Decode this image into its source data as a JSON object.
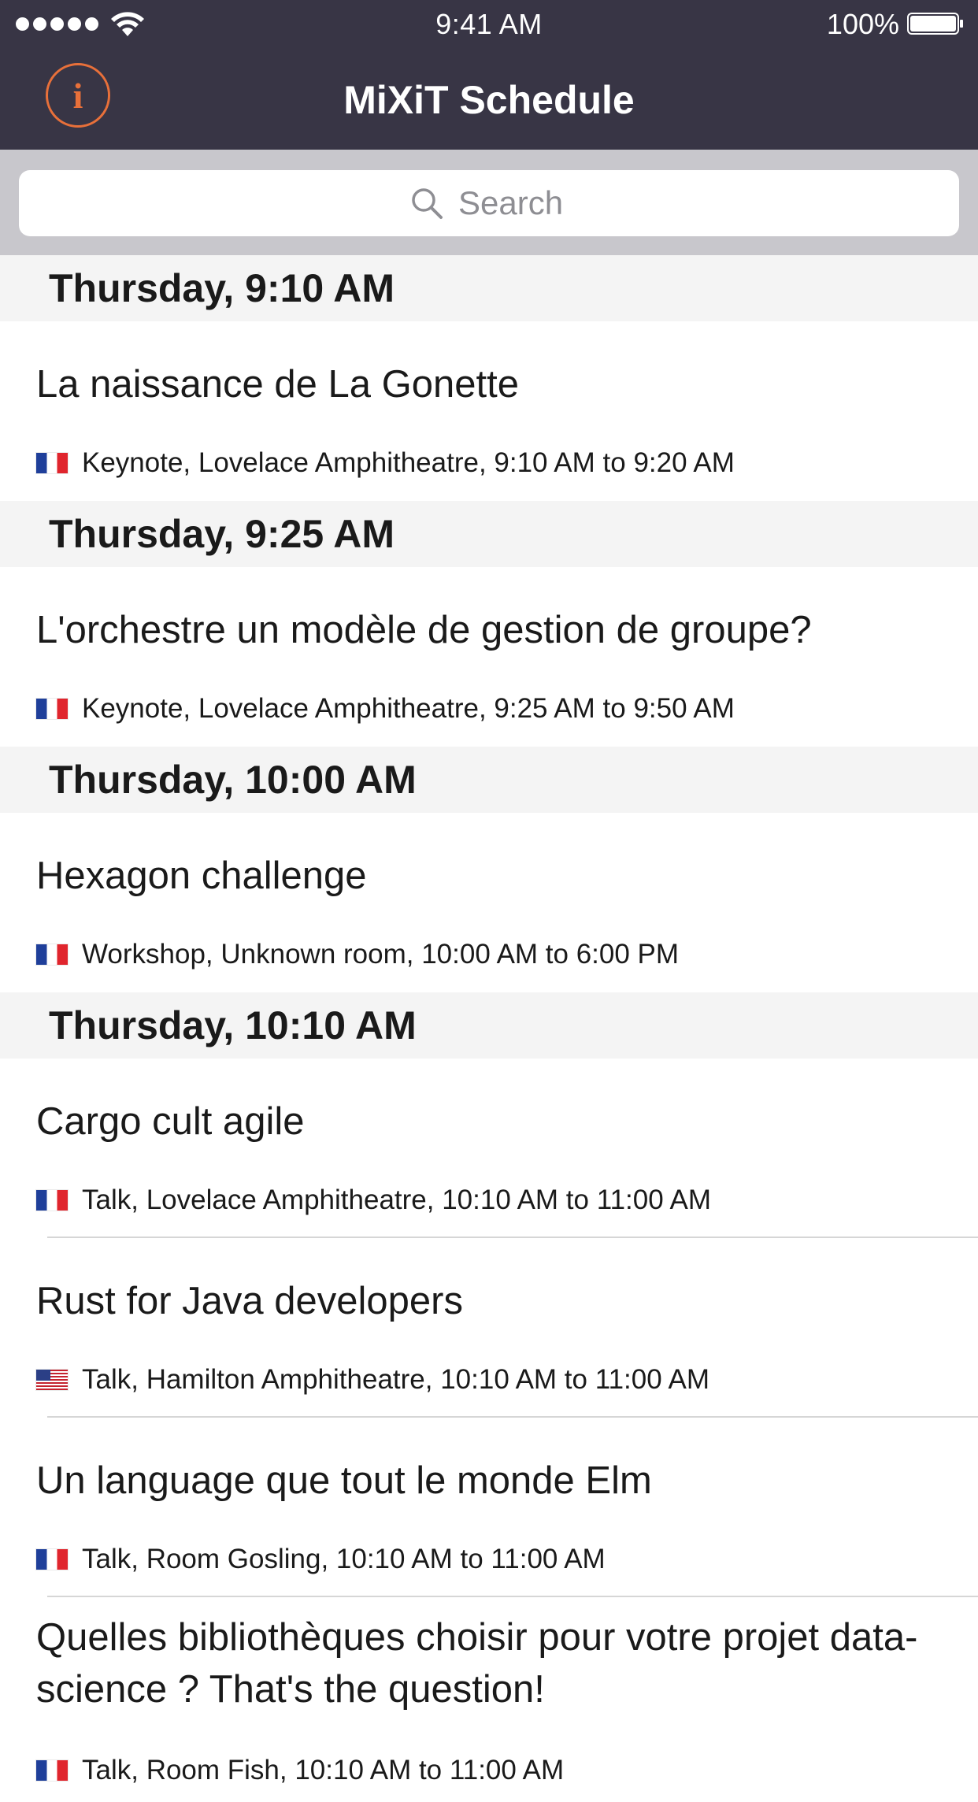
{
  "status_bar": {
    "time": "9:41 AM",
    "battery": "100%"
  },
  "nav": {
    "title": "MiXiT Schedule",
    "info_icon": "i"
  },
  "search": {
    "placeholder": "Search"
  },
  "sections": [
    {
      "header": "Thursday, 9:10 AM",
      "sessions": [
        {
          "title": "La naissance de La Gonette",
          "flag": "fr",
          "meta": "Keynote, Lovelace Amphitheatre, 9:10 AM to 9:20 AM"
        }
      ]
    },
    {
      "header": "Thursday, 9:25 AM",
      "sessions": [
        {
          "title": "L'orchestre un modèle de gestion de groupe?",
          "flag": "fr",
          "meta": "Keynote, Lovelace Amphitheatre, 9:25 AM to 9:50 AM"
        }
      ]
    },
    {
      "header": "Thursday, 10:00 AM",
      "sessions": [
        {
          "title": "Hexagon challenge",
          "flag": "fr",
          "meta": "Workshop, Unknown room, 10:00 AM to 6:00 PM"
        }
      ]
    },
    {
      "header": "Thursday, 10:10 AM",
      "sessions": [
        {
          "title": "Cargo cult agile",
          "flag": "fr",
          "meta": "Talk, Lovelace Amphitheatre, 10:10 AM to 11:00 AM"
        },
        {
          "title": "Rust for Java developers",
          "flag": "us",
          "meta": "Talk, Hamilton Amphitheatre, 10:10 AM to 11:00 AM"
        },
        {
          "title": "Un language que tout le monde Elm",
          "flag": "fr",
          "meta": "Talk, Room Gosling, 10:10 AM to 11:00 AM"
        },
        {
          "title": "Quelles bibliothèques choisir pour votre projet data-science ? That's the question!",
          "flag": "fr",
          "meta": "Talk, Room Fish, 10:10 AM to 11:00 AM"
        }
      ]
    }
  ]
}
